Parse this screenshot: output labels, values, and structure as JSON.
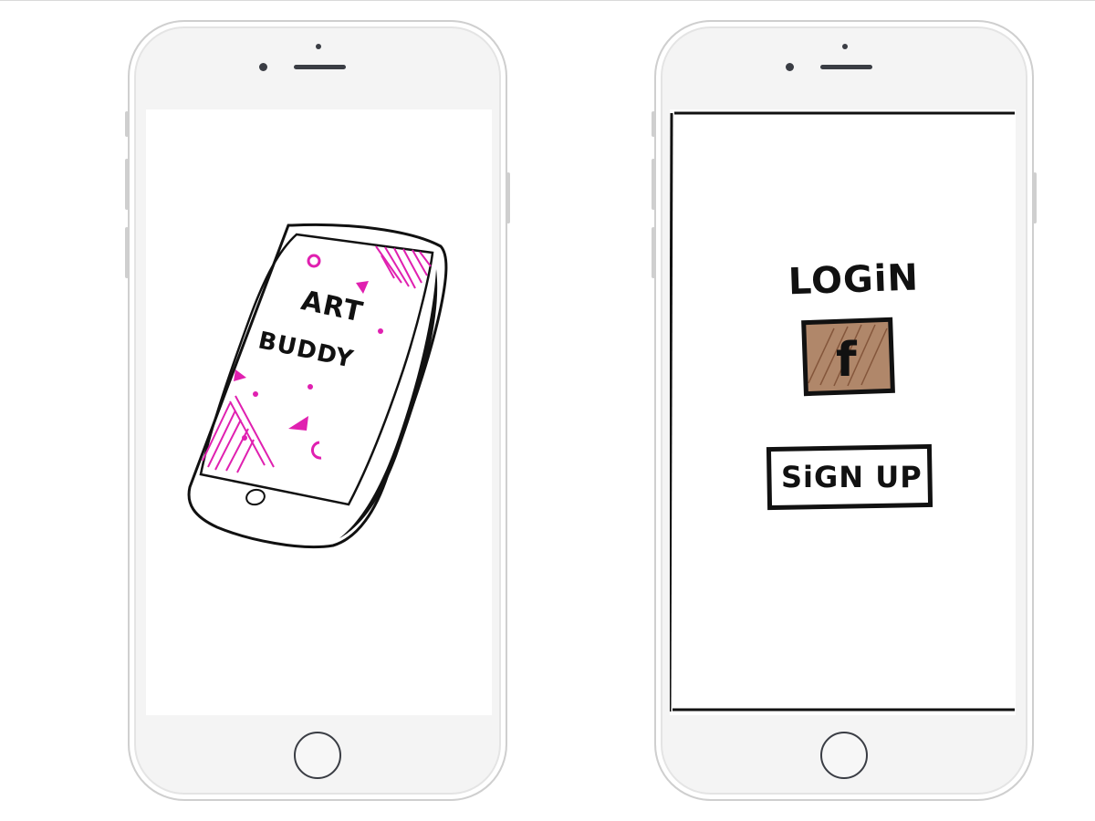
{
  "splash_screen": {
    "title_line1": "ART",
    "title_line2": "BUDDY",
    "accent_color": "#e020b0"
  },
  "login_screen": {
    "login_label": "LOGiN",
    "facebook_glyph": "f",
    "signup_label": "SiGN UP",
    "facebook_fill_color": "#b0876a"
  }
}
